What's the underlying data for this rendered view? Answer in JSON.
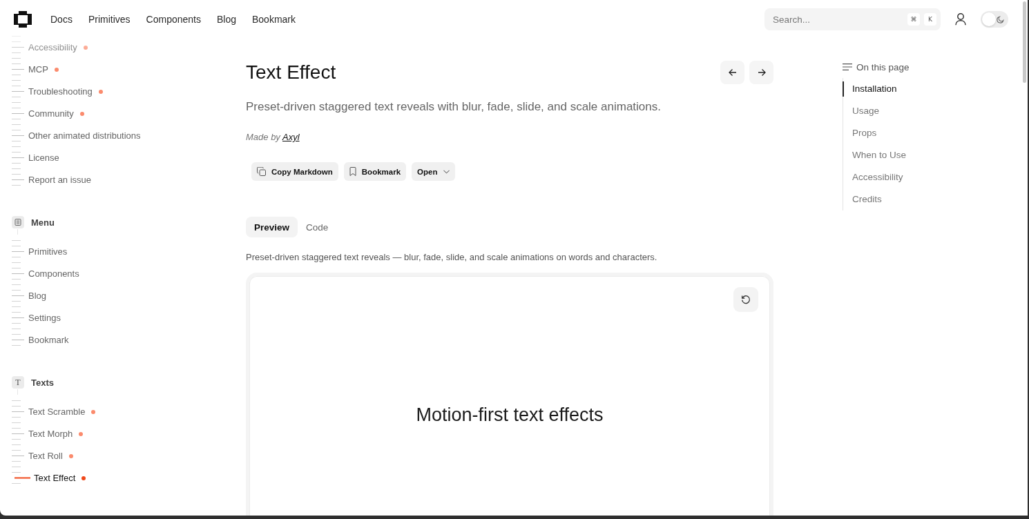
{
  "header": {
    "nav": [
      {
        "label": "Docs"
      },
      {
        "label": "Primitives"
      },
      {
        "label": "Components"
      },
      {
        "label": "Blog"
      },
      {
        "label": "Bookmark"
      }
    ],
    "search": {
      "placeholder": "Search...",
      "keys": [
        "⌘",
        "K"
      ]
    },
    "theme_toggle": {
      "on": false
    }
  },
  "sidebar": {
    "items": [
      {
        "label": "Accessibility",
        "dot": true,
        "selected": false
      },
      {
        "label": "MCP",
        "dot": true,
        "selected": false
      },
      {
        "label": "Troubleshooting",
        "dot": true,
        "selected": false
      },
      {
        "label": "Community",
        "dot": true,
        "selected": false
      },
      {
        "label": "Other animated distributions",
        "dot": false,
        "selected": false
      },
      {
        "label": "License",
        "dot": false,
        "selected": false
      },
      {
        "label": "Report an issue",
        "dot": false,
        "selected": false
      }
    ],
    "sections": [
      {
        "title": "Menu",
        "kind": "list",
        "items": [
          {
            "label": "Primitives",
            "dot": false,
            "selected": false
          },
          {
            "label": "Components",
            "dot": false,
            "selected": false
          },
          {
            "label": "Blog",
            "dot": false,
            "selected": false
          },
          {
            "label": "Settings",
            "dot": false,
            "selected": false
          },
          {
            "label": "Bookmark",
            "dot": false,
            "selected": false
          }
        ]
      },
      {
        "title": "Texts",
        "kind": "letter",
        "letter": "T",
        "items": [
          {
            "label": "Text Scramble",
            "dot": true,
            "selected": false
          },
          {
            "label": "Text Morph",
            "dot": true,
            "selected": false
          },
          {
            "label": "Text Roll",
            "dot": true,
            "selected": false
          },
          {
            "label": "Text Effect",
            "dot": true,
            "selected": true
          }
        ]
      }
    ]
  },
  "page": {
    "title": "Text Effect",
    "description": "Preset-driven staggered text reveals with blur, fade, slide, and scale animations.",
    "author_prefix": "Made by",
    "author": "Axyl",
    "actions": [
      {
        "label": "Copy Markdown",
        "kind": "copy"
      },
      {
        "label": "Bookmark",
        "kind": "bookmark"
      },
      {
        "label": "Open",
        "kind": "dropdown"
      }
    ],
    "tabs": [
      {
        "label": "Preview",
        "selected": true
      },
      {
        "label": "Code",
        "selected": false
      }
    ],
    "preview": {
      "caption": "Preset-driven staggered text reveals — blur, fade, slide, and scale animations on words and characters.",
      "text": "Motion-first text effects"
    }
  },
  "toc": {
    "title": "On this page",
    "items": [
      {
        "label": "Installation",
        "selected": true
      },
      {
        "label": "Usage",
        "selected": false
      },
      {
        "label": "Props",
        "selected": false
      },
      {
        "label": "When to Use",
        "selected": false
      },
      {
        "label": "Accessibility",
        "selected": false
      },
      {
        "label": "Credits",
        "selected": false
      }
    ]
  }
}
